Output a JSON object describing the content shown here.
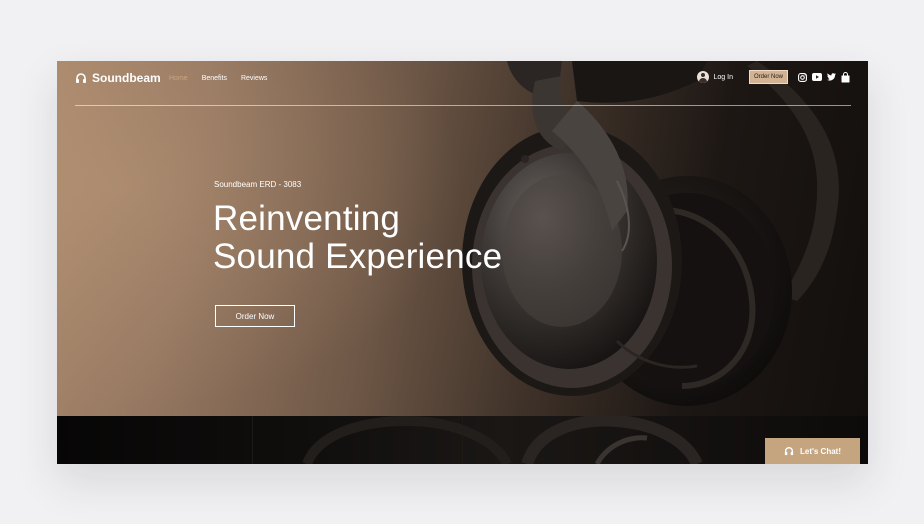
{
  "header": {
    "brand": "Soundbeam",
    "nav": [
      {
        "label": "Home",
        "active": true
      },
      {
        "label": "Benefits",
        "active": false
      },
      {
        "label": "Reviews",
        "active": false
      }
    ],
    "login_label": "Log In",
    "order_label": "Order Now",
    "social_icons": [
      "instagram-icon",
      "youtube-icon",
      "twitter-icon",
      "cart-icon"
    ]
  },
  "hero": {
    "eyebrow": "Soundbeam ERD - 3083",
    "headline_line1": "Reinventing",
    "headline_line2": "Sound Experience",
    "cta_label": "Order Now"
  },
  "chat": {
    "label": "Let's Chat!"
  },
  "colors": {
    "accent": "#c4a580",
    "nav_active": "#c9a57f",
    "hero_light": "#a8876b",
    "hero_dark": "#120f0d"
  }
}
